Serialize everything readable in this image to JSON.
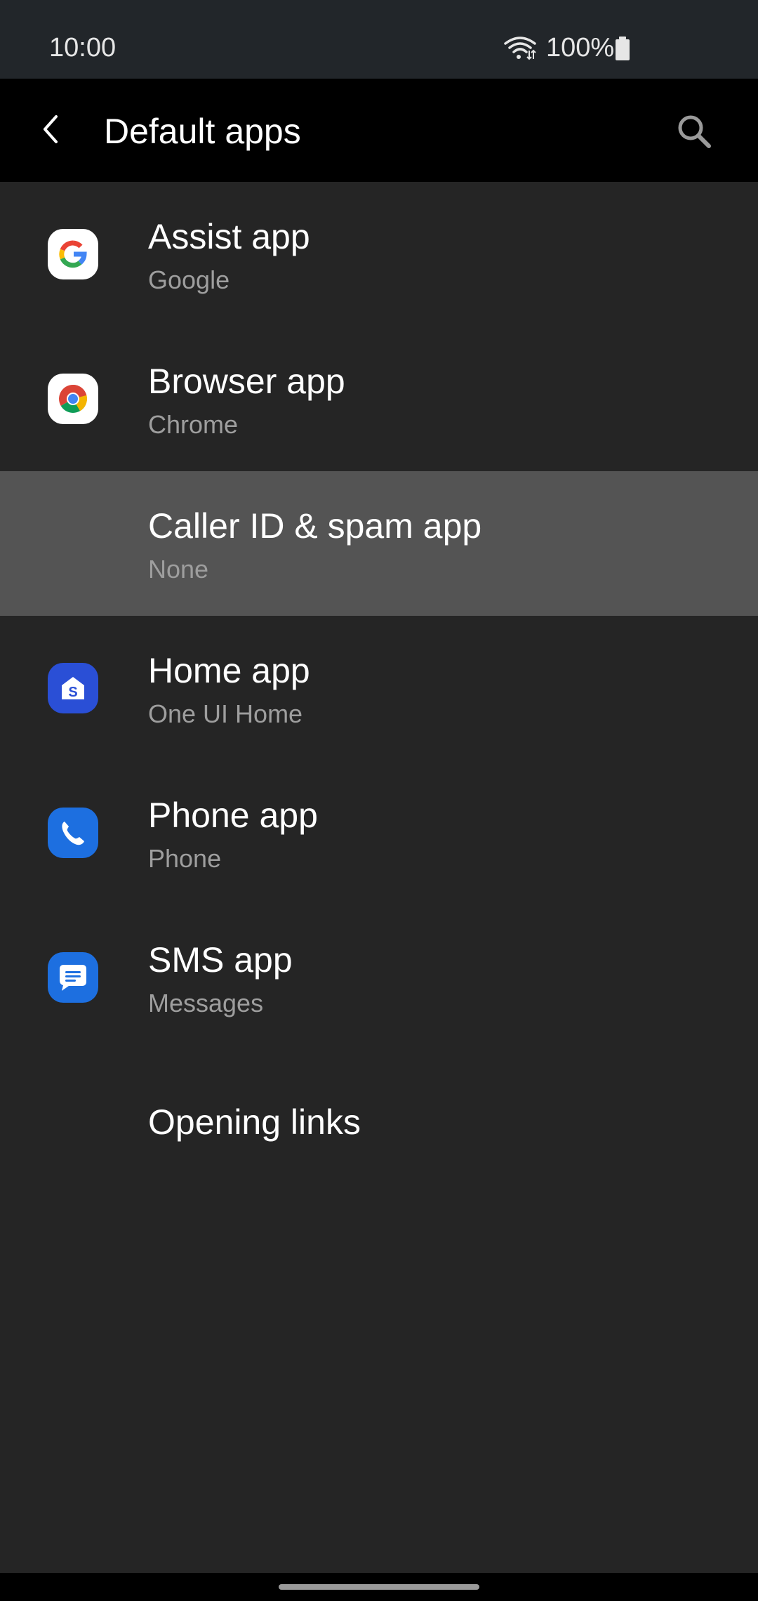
{
  "status_bar": {
    "time": "10:00",
    "battery_percent": "100%",
    "wifi_icon": "wifi-icon",
    "battery_icon": "battery-icon"
  },
  "app_bar": {
    "title": "Default apps",
    "back_icon": "back-arrow-icon",
    "search_icon": "search-icon"
  },
  "items": [
    {
      "title": "Assist app",
      "subtitle": "Google",
      "icon": "google-icon"
    },
    {
      "title": "Browser app",
      "subtitle": "Chrome",
      "icon": "chrome-icon"
    },
    {
      "title": "Caller ID & spam app",
      "subtitle": "None",
      "icon": ""
    },
    {
      "title": "Home app",
      "subtitle": "One UI Home",
      "icon": "one-ui-home-icon"
    },
    {
      "title": "Phone app",
      "subtitle": "Phone",
      "icon": "phone-icon"
    },
    {
      "title": "SMS app",
      "subtitle": "Messages",
      "icon": "messages-icon"
    },
    {
      "title": "Opening links",
      "subtitle": "",
      "icon": ""
    }
  ],
  "colors": {
    "background": "#252525",
    "status_bar": "#22262a",
    "app_bar": "#000000",
    "highlight_row": "#545454",
    "subtitle_text": "#9e9e9e",
    "samsung_blue": "#1d6fe0"
  }
}
